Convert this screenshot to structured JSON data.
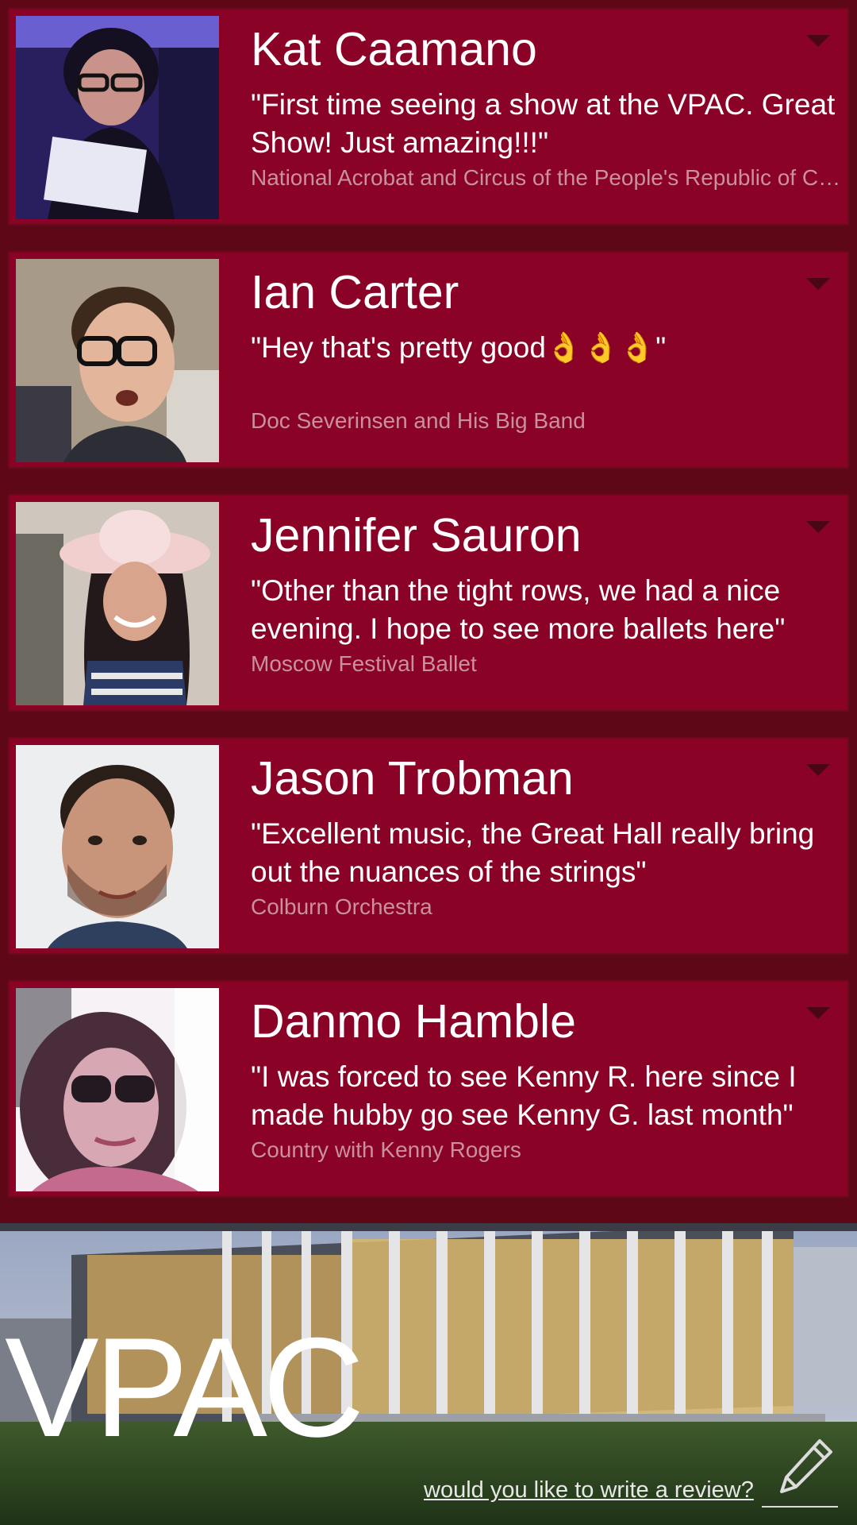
{
  "reviews": [
    {
      "name": "Kat Caamano",
      "quote": "\"First time seeing a show at the VPAC. Great Show! Just amazing!!!\"",
      "show": "National Acrobat and Circus of the People's Republic of China"
    },
    {
      "name": "Ian Carter",
      "quote": "\"Hey that's pretty good👌👌👌\"",
      "show": "Doc Severinsen and His Big Band"
    },
    {
      "name": "Jennifer Sauron",
      "quote": "\"Other than the tight rows, we had a nice evening. I hope to see more ballets here\"",
      "show": "Moscow Festival Ballet"
    },
    {
      "name": "Jason Trobman",
      "quote": "\"Excellent music, the Great Hall really bring out the nuances of the strings\"",
      "show": "Colburn Orchestra"
    },
    {
      "name": "Danmo Hamble",
      "quote": "\"I was forced to see Kenny R. here since I made hubby go see Kenny G. last month\"",
      "show": "Country with Kenny Rogers"
    }
  ],
  "footer": {
    "brand": "VPAC",
    "write_review_label": "would you like to write a review?",
    "pencil_icon": "pencil-icon"
  },
  "colors": {
    "card": "#8a0226",
    "background": "#5e0716",
    "subtext": "#c9909e"
  }
}
